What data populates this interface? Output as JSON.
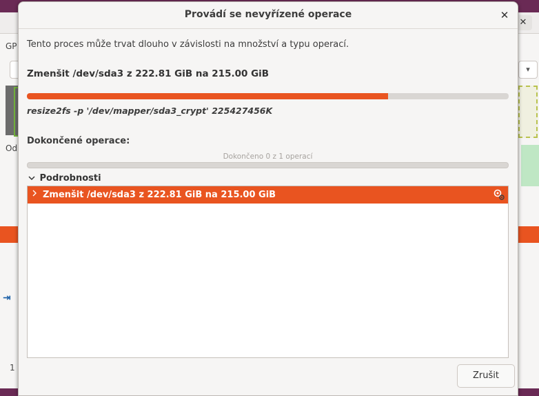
{
  "background": {
    "close_glyph": "✕",
    "menu_label": "GP",
    "column_label": "Od",
    "row_number": "1"
  },
  "dialog": {
    "title": "Provádí se nevyřízené operace",
    "close_glyph": "✕",
    "info": "Tento proces může trvat dlouho v závislosti na množství a typu operací.",
    "current_operation": "Zmenšit /dev/sda3 z 222.81 GiB na 215.00 GiB",
    "current_progress": 0.75,
    "command": "resize2fs -p '/dev/mapper/sda3_crypt' 225427456K",
    "completed_label": "Dokončené operace:",
    "completed_count_text": "Dokončeno 0 z 1 operací",
    "completed_progress": 0,
    "details_label": "Podrobnosti",
    "details_items": [
      {
        "label": "Zmenšit /dev/sda3 z 222.81 GiB na 215.00 GiB",
        "status_icon": "running-gears-icon"
      }
    ],
    "cancel_label": "Zrušit"
  },
  "colors": {
    "accent": "#e95420",
    "dialog_bg": "#f6f5f4"
  }
}
